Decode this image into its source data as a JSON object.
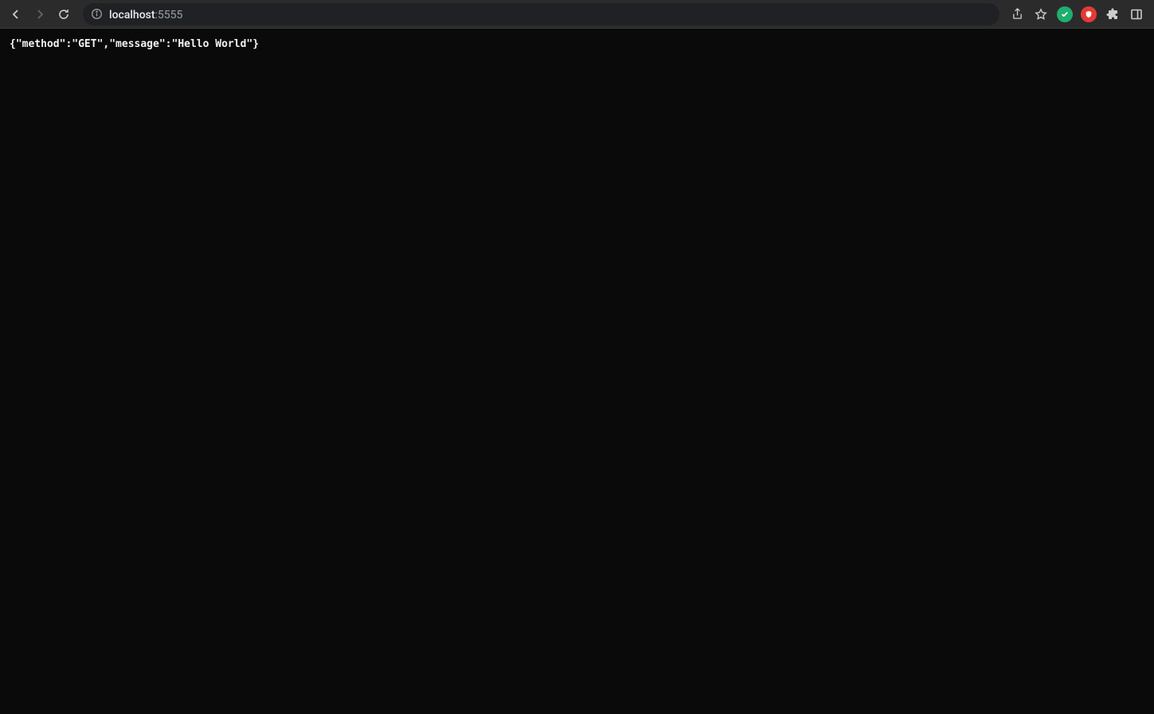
{
  "address": {
    "host": "localhost",
    "port": ":5555"
  },
  "page": {
    "body_text": "{\"method\":\"GET\",\"message\":\"Hello World\"}"
  },
  "icons": {
    "back": "back-icon",
    "forward": "forward-icon",
    "reload": "reload-icon",
    "site_info": "info-icon",
    "share": "share-icon",
    "bookmark": "star-icon",
    "ext_green": "extension-green",
    "ext_red": "extension-red",
    "extensions": "puzzle-icon",
    "panel": "panel-icon"
  }
}
